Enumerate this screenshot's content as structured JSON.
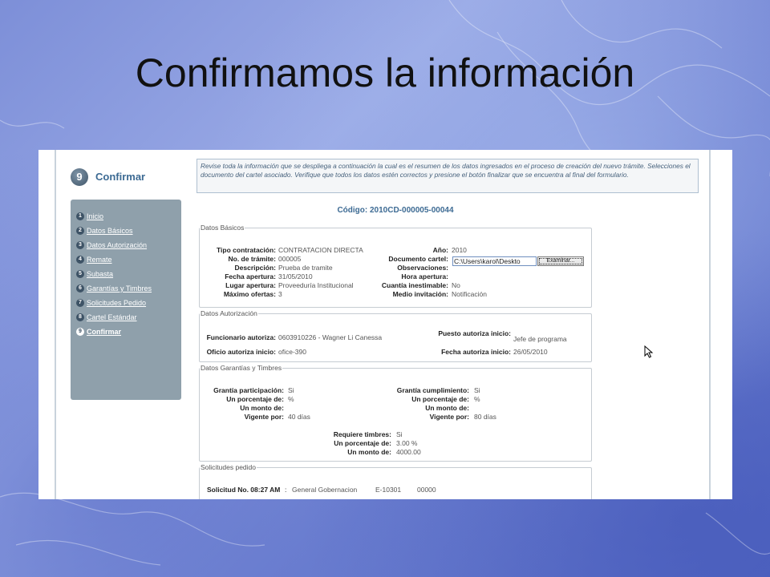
{
  "slide_title": "Confirmamos la información",
  "header": {
    "step": "9",
    "title": "Confirmar"
  },
  "sidebar": {
    "items": [
      {
        "num": "1",
        "label": "Inicio"
      },
      {
        "num": "2",
        "label": "Datos Básicos"
      },
      {
        "num": "3",
        "label": "Datos Autorización"
      },
      {
        "num": "4",
        "label": "Remate"
      },
      {
        "num": "5",
        "label": "Subasta"
      },
      {
        "num": "6",
        "label": "Garantías y Timbres"
      },
      {
        "num": "7",
        "label": "Solicitudes Pedido"
      },
      {
        "num": "8",
        "label": "Cartel Estándar"
      },
      {
        "num": "9",
        "label": "Confirmar"
      }
    ]
  },
  "info_text": "Revise toda la información que se despliega a continuación la cual es el resumen de los datos ingresados en el proceso de creación del nuevo trámite. Selecciones el documento del cartel asociado. Verifique que todos los datos estén correctos y presione el botón finalizar que se encuentra al final del formulario.",
  "codigo": "Código: 2010CD-000005-00044",
  "datos_basicos": {
    "legend": "Datos Básicos",
    "tipo_label": "Tipo contratación:",
    "tipo_value": "CONTRATACION DIRECTA",
    "tramite_label": "No. de trámite:",
    "tramite_value": "000005",
    "desc_label": "Descripción:",
    "desc_value": "Prueba de tramite",
    "fecha_label": "Fecha apertura:",
    "fecha_value": "31/05/2010",
    "lugar_label": "Lugar apertura:",
    "lugar_value": "Proveeduría Institucional",
    "max_label": "Máximo ofertas:",
    "max_value": "3",
    "anio_label": "Año:",
    "anio_value": "2010",
    "doc_label": "Documento cartel:",
    "doc_value": "C:\\Users\\karol\\Deskto",
    "examinar": "Examinar...",
    "obs_label": "Observaciones:",
    "hora_label": "Hora apertura:",
    "cuantia_label": "Cuantía inestimable:",
    "cuantia_value": "No",
    "medio_label": "Medio invitación:",
    "medio_value": "Notificación"
  },
  "datos_autorizacion": {
    "legend": "Datos Autorización",
    "func_label": "Funcionario autoriza:",
    "func_value": "0603910226 - Wagner Li Canessa",
    "oficio_label": "Oficio autoriza inicio:",
    "oficio_value": "ofice-390",
    "puesto_label": "Puesto autoriza inicio:",
    "puesto_value": "Jefe de programa",
    "fecha_label": "Fecha autoriza inicio:",
    "fecha_value": "26/05/2010"
  },
  "datos_garantias": {
    "legend": "Datos Garantías y Timbres",
    "gp_label": "Grantía participación:",
    "gp_value": "Si",
    "pct1_label": "Un porcentaje de:",
    "pct1_value": "%",
    "monto1_label": "Un monto de:",
    "vig1_label": "Vigente por:",
    "vig1_value": "40 días",
    "gc_label": "Grantía cumplimiento:",
    "gc_value": "Si",
    "pct2_label": "Un porcentaje de:",
    "pct2_value": "%",
    "monto2_label": "Un monto de:",
    "vig2_label": "Vigente por:",
    "vig2_value": "80 días",
    "timbres_label": "Requiere timbres:",
    "timbres_value": "Si",
    "pct3_label": "Un porcentaje de:",
    "pct3_value": "3.00 %",
    "monto3_label": "Un monto de:",
    "monto3_value": "4000.00"
  },
  "solicitudes": {
    "legend": "Solicitudes pedido",
    "sol_label": "Solicitud No. 08:27 AM",
    "sol_sep": ":",
    "sol_dept": "General Gobernacion",
    "sol_code": "E-10301",
    "sol_num": "00000"
  }
}
